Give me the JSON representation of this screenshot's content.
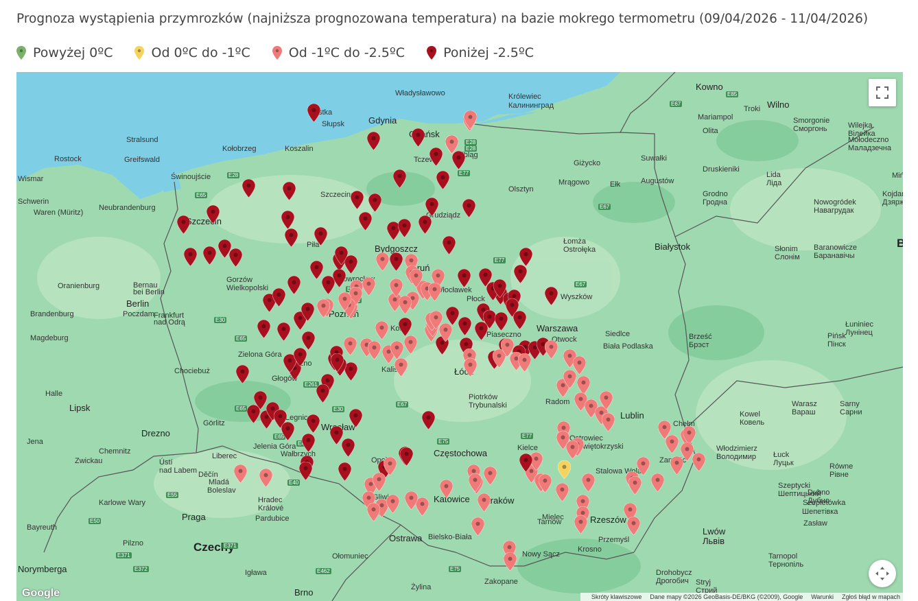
{
  "title": "Prognoza wystąpienia przymrozków (najniższa prognozowana temperatura) na bazie mokrego termometru (09/04/2026 - 11/04/2026)",
  "legend": [
    {
      "label": "Powyżej 0ºC",
      "color": "#7bb26a"
    },
    {
      "label": "Od 0ºC do -1ºC",
      "color": "#f5d35f"
    },
    {
      "label": "Od -1ºC do -2.5ºC",
      "color": "#f07a78"
    },
    {
      "label": "Poniżej -2.5ºC",
      "color": "#a8101e"
    }
  ],
  "map": {
    "icons": {
      "fullscreen": "fullscreen-icon",
      "camera": "camera-move-icon"
    },
    "attribution": {
      "shortcuts": "Skróty klawiszowe",
      "data": "Dane mapy ©2026 GeoBasis-DE/BKG (©2009), Google",
      "terms": "Warunki",
      "report": "Zgłoś błąd w mapach"
    },
    "logo": "Google",
    "labels": [
      {
        "t": "Władysławowo",
        "c": "lbl"
      },
      {
        "t": "Gdynia",
        "c": "lbl city"
      },
      {
        "t": "Gdańsk",
        "c": "lbl city"
      },
      {
        "t": "Ustka",
        "c": "lbl"
      },
      {
        "t": "Słupsk",
        "c": "lbl"
      },
      {
        "t": "Koszalin",
        "c": "lbl"
      },
      {
        "t": "Kołobrzeg",
        "c": "lbl"
      },
      {
        "t": "Tczew",
        "c": "lbl"
      },
      {
        "t": "Elbląg",
        "c": "lbl"
      },
      {
        "t": "Olsztyn",
        "c": "lbl"
      },
      {
        "t": "Królewiec",
        "c": "lbl"
      },
      {
        "t": "Калининград",
        "c": "lbl"
      },
      {
        "t": "Stralsund",
        "c": "lbl"
      },
      {
        "t": "Rostock",
        "c": "lbl"
      },
      {
        "t": "Greifswald",
        "c": "lbl"
      },
      {
        "t": "Wismar",
        "c": "lbl"
      },
      {
        "t": "Świnoujście",
        "c": "lbl"
      },
      {
        "t": "Schwerin",
        "c": "lbl"
      },
      {
        "t": "Neubrandenburg",
        "c": "lbl"
      },
      {
        "t": "Waren (Müritz)",
        "c": "lbl"
      },
      {
        "t": "Szczecin",
        "c": "lbl city"
      },
      {
        "t": "Szczecinek",
        "c": "lbl"
      },
      {
        "t": "Grudziądz",
        "c": "lbl"
      },
      {
        "t": "Bydgoszcz",
        "c": "lbl city"
      },
      {
        "t": "Toruń",
        "c": "lbl city"
      },
      {
        "t": "Piła",
        "c": "lbl"
      },
      {
        "t": "Inowrocław",
        "c": "lbl"
      },
      {
        "t": "Włocławek",
        "c": "lbl"
      },
      {
        "t": "Płock",
        "c": "lbl"
      },
      {
        "t": "Gorzów",
        "c": "lbl"
      },
      {
        "t": "Wielkopolski",
        "c": "lbl"
      },
      {
        "t": "Berlin",
        "c": "lbl city"
      },
      {
        "t": "Bernau",
        "c": "lbl"
      },
      {
        "t": "bei Berlin",
        "c": "lbl"
      },
      {
        "t": "Oranienburg",
        "c": "lbl"
      },
      {
        "t": "Poczdam",
        "c": "lbl"
      },
      {
        "t": "Brandenburg",
        "c": "lbl"
      },
      {
        "t": "Frankfurt",
        "c": "lbl"
      },
      {
        "t": "nad Odrą",
        "c": "lbl"
      },
      {
        "t": "Poznań",
        "c": "lbl city"
      },
      {
        "t": "Konin",
        "c": "lbl"
      },
      {
        "t": "Magdeburg",
        "c": "lbl"
      },
      {
        "t": "Zielona Góra",
        "c": "lbl"
      },
      {
        "t": "Leszno",
        "c": "lbl"
      },
      {
        "t": "Kalisz",
        "c": "lbl"
      },
      {
        "t": "Łódź",
        "c": "lbl city"
      },
      {
        "t": "Warszawa",
        "c": "lbl city"
      },
      {
        "t": "Piaseczno",
        "c": "lbl"
      },
      {
        "t": "Otwock",
        "c": "lbl"
      },
      {
        "t": "Chociebuż",
        "c": "lbl"
      },
      {
        "t": "Głogów",
        "c": "lbl"
      },
      {
        "t": "Halle",
        "c": "lbl"
      },
      {
        "t": "Lipsk",
        "c": "lbl city"
      },
      {
        "t": "Legnica",
        "c": "lbl"
      },
      {
        "t": "Wrocław",
        "c": "lbl city"
      },
      {
        "t": "Piotrków",
        "c": "lbl"
      },
      {
        "t": "Trybunalski",
        "c": "lbl"
      },
      {
        "t": "Radom",
        "c": "lbl"
      },
      {
        "t": "Lublin",
        "c": "lbl city"
      },
      {
        "t": "Drezno",
        "c": "lbl city"
      },
      {
        "t": "Görlitz",
        "c": "lbl"
      },
      {
        "t": "Jelenia Góra",
        "c": "lbl"
      },
      {
        "t": "Wałbrzych",
        "c": "lbl"
      },
      {
        "t": "Opole",
        "c": "lbl"
      },
      {
        "t": "Częstochowa",
        "c": "lbl city"
      },
      {
        "t": "Kielce",
        "c": "lbl"
      },
      {
        "t": "Ostrowiec",
        "c": "lbl"
      },
      {
        "t": "Świętokrzyski",
        "c": "lbl"
      },
      {
        "t": "Stalowa Wola",
        "c": "lbl"
      },
      {
        "t": "Zamość",
        "c": "lbl"
      },
      {
        "t": "Jena",
        "c": "lbl"
      },
      {
        "t": "Chemnitz",
        "c": "lbl"
      },
      {
        "t": "Zwickau",
        "c": "lbl"
      },
      {
        "t": "Liberec",
        "c": "lbl"
      },
      {
        "t": "Ústí",
        "c": "lbl"
      },
      {
        "t": "nad Labem",
        "c": "lbl"
      },
      {
        "t": "Děčín",
        "c": "lbl"
      },
      {
        "t": "Mladá",
        "c": "lbl"
      },
      {
        "t": "Boleslav",
        "c": "lbl"
      },
      {
        "t": "Hradec",
        "c": "lbl"
      },
      {
        "t": "Králové",
        "c": "lbl"
      },
      {
        "t": "Pardubice",
        "c": "lbl"
      },
      {
        "t": "Praga",
        "c": "lbl city"
      },
      {
        "t": "Karlowe Wary",
        "c": "lbl"
      },
      {
        "t": "Gliwice",
        "c": "lbl"
      },
      {
        "t": "Katowice",
        "c": "lbl city"
      },
      {
        "t": "Kraków",
        "c": "lbl city"
      },
      {
        "t": "Tarnów",
        "c": "lbl"
      },
      {
        "t": "Mielec",
        "c": "lbl"
      },
      {
        "t": "Rzeszów",
        "c": "lbl city"
      },
      {
        "t": "Przemyśl",
        "c": "lbl"
      },
      {
        "t": "Krosno",
        "c": "lbl"
      },
      {
        "t": "Nowy Sącz",
        "c": "lbl"
      },
      {
        "t": "Bielsko-Biała",
        "c": "lbl"
      },
      {
        "t": "Ostrawa",
        "c": "lbl city"
      },
      {
        "t": "Zakopane",
        "c": "lbl"
      },
      {
        "t": "Żylina",
        "c": "lbl"
      },
      {
        "t": "Brno",
        "c": "lbl city"
      },
      {
        "t": "Ołomuniec",
        "c": "lbl"
      },
      {
        "t": "Igława",
        "c": "lbl"
      },
      {
        "t": "Pilzno",
        "c": "lbl"
      },
      {
        "t": "Bayreuth",
        "c": "lbl"
      },
      {
        "t": "Norymberga",
        "c": "lbl city"
      },
      {
        "t": "Czechy",
        "c": "lbl big"
      },
      {
        "t": "Łomża",
        "c": "lbl"
      },
      {
        "t": "Białystok",
        "c": "lbl city"
      },
      {
        "t": "Ostrołęka",
        "c": "lbl"
      },
      {
        "t": "Wyszków",
        "c": "lbl"
      },
      {
        "t": "Siedlce",
        "c": "lbl"
      },
      {
        "t": "Biała Podlaska",
        "c": "lbl"
      },
      {
        "t": "Chełm",
        "c": "lbl"
      },
      {
        "t": "Mrągowo",
        "c": "lbl"
      },
      {
        "t": "Ełk",
        "c": "lbl"
      },
      {
        "t": "Giżycko",
        "c": "lbl"
      },
      {
        "t": "Suwałki",
        "c": "lbl"
      },
      {
        "t": "Augustów",
        "c": "lbl"
      },
      {
        "t": "Kowno",
        "c": "lbl city"
      },
      {
        "t": "Wilno",
        "c": "lbl city"
      },
      {
        "t": "Troki",
        "c": "lbl"
      },
      {
        "t": "Olita",
        "c": "lbl"
      },
      {
        "t": "Mariampol",
        "c": "lbl"
      },
      {
        "t": "Druskieniki",
        "c": "lbl"
      },
      {
        "t": "Grodno",
        "c": "lbl"
      },
      {
        "t": "Гродна",
        "c": "lbl"
      },
      {
        "t": "Lida",
        "c": "lbl"
      },
      {
        "t": "Ліда",
        "c": "lbl"
      },
      {
        "t": "Smorgonie",
        "c": "lbl"
      },
      {
        "t": "Сморгонь",
        "c": "lbl"
      },
      {
        "t": "Wilejka",
        "c": "lbl"
      },
      {
        "t": "Вілейка",
        "c": "lbl"
      },
      {
        "t": "Mołodeczno",
        "c": "lbl"
      },
      {
        "t": "Маладзечна",
        "c": "lbl"
      },
      {
        "t": "Nowogródek",
        "c": "lbl"
      },
      {
        "t": "Навагрудак",
        "c": "lbl"
      },
      {
        "t": "Kojdanów",
        "c": "lbl"
      },
      {
        "t": "Дзяржынск",
        "c": "lbl"
      },
      {
        "t": "Baranowicze",
        "c": "lbl"
      },
      {
        "t": "Баранавічы",
        "c": "lbl"
      },
      {
        "t": "Słonim",
        "c": "lbl"
      },
      {
        "t": "Слонім",
        "c": "lbl"
      },
      {
        "t": "Brześć",
        "c": "lbl"
      },
      {
        "t": "Брэст",
        "c": "lbl"
      },
      {
        "t": "Pińsk",
        "c": "lbl"
      },
      {
        "t": "Пінск",
        "c": "lbl"
      },
      {
        "t": "Łuniniec",
        "c": "lbl"
      },
      {
        "t": "Лунінец",
        "c": "lbl"
      },
      {
        "t": "Kowel",
        "c": "lbl"
      },
      {
        "t": "Ковель",
        "c": "lbl"
      },
      {
        "t": "Warasz",
        "c": "lbl"
      },
      {
        "t": "Вараш",
        "c": "lbl"
      },
      {
        "t": "Sarny",
        "c": "lbl"
      },
      {
        "t": "Сарни",
        "c": "lbl"
      },
      {
        "t": "Łuck",
        "c": "lbl"
      },
      {
        "t": "Луцьк",
        "c": "lbl"
      },
      {
        "t": "Równe",
        "c": "lbl"
      },
      {
        "t": "Рівне",
        "c": "lbl"
      },
      {
        "t": "Włodzimierz",
        "c": "lbl"
      },
      {
        "t": "Володимир",
        "c": "lbl"
      },
      {
        "t": "Szeptycki",
        "c": "lbl"
      },
      {
        "t": "Шептицький",
        "c": "lbl"
      },
      {
        "t": "Dubno",
        "c": "lbl"
      },
      {
        "t": "Дубно",
        "c": "lbl"
      },
      {
        "t": "Zasław",
        "c": "lbl"
      },
      {
        "t": "Szepietówka",
        "c": "lbl"
      },
      {
        "t": "Шепетівка",
        "c": "lbl"
      },
      {
        "t": "Lwów",
        "c": "lbl city"
      },
      {
        "t": "Львів",
        "c": "lbl city"
      },
      {
        "t": "Tarnopol",
        "c": "lbl"
      },
      {
        "t": "Тернопіль",
        "c": "lbl"
      },
      {
        "t": "Drohobycz",
        "c": "lbl"
      },
      {
        "t": "Дрогобич",
        "c": "lbl"
      },
      {
        "t": "Stryj",
        "c": "lbl"
      },
      {
        "t": "Стрий",
        "c": "lbl"
      },
      {
        "t": "Mińsk",
        "c": "lbl"
      },
      {
        "t": "Białoruś",
        "c": "lbl big"
      }
    ],
    "roads": [
      "E28",
      "E65",
      "E28",
      "E77",
      "E28",
      "E77",
      "E67",
      "E67",
      "E85",
      "E67",
      "E65",
      "E30",
      "E261",
      "E261",
      "E261",
      "E65",
      "E65",
      "E30",
      "E40",
      "E40",
      "E75",
      "E77",
      "E67",
      "E462",
      "E55",
      "E50",
      "E371",
      "E372",
      "E371",
      "E75"
    ],
    "markers": [
      {
        "level": 3
      },
      {
        "level": 2
      },
      {
        "level": 3
      },
      {
        "level": 3
      },
      {
        "level": 2
      },
      {
        "level": 3
      },
      {
        "level": 3
      },
      {
        "level": 3
      },
      {
        "level": 3
      },
      {
        "level": 3
      },
      {
        "level": 3
      },
      {
        "level": 3
      },
      {
        "level": 3
      },
      {
        "level": 3
      },
      {
        "level": 3
      },
      {
        "level": 3
      },
      {
        "level": 3
      },
      {
        "level": 3
      },
      {
        "level": 3
      },
      {
        "level": 3
      },
      {
        "level": 3
      },
      {
        "level": 3
      },
      {
        "level": 3
      },
      {
        "level": 3
      },
      {
        "level": 3
      },
      {
        "level": 3
      },
      {
        "level": 3
      },
      {
        "level": 3
      },
      {
        "level": 3
      },
      {
        "level": 3
      },
      {
        "level": 3
      },
      {
        "level": 3
      },
      {
        "level": 3
      },
      {
        "level": 3
      },
      {
        "level": 3
      },
      {
        "level": 3
      },
      {
        "level": 3
      },
      {
        "level": 3
      },
      {
        "level": 3
      },
      {
        "level": 3
      },
      {
        "level": 3
      },
      {
        "level": 3
      },
      {
        "level": 3
      },
      {
        "level": 3
      },
      {
        "level": 3
      },
      {
        "level": 3
      },
      {
        "level": 3
      },
      {
        "level": 3
      },
      {
        "level": 3
      },
      {
        "level": 3
      },
      {
        "level": 3
      },
      {
        "level": 3
      },
      {
        "level": 3
      },
      {
        "level": 3
      },
      {
        "level": 3
      },
      {
        "level": 3
      },
      {
        "level": 3
      },
      {
        "level": 3
      },
      {
        "level": 3
      },
      {
        "level": 3
      },
      {
        "level": 3
      },
      {
        "level": 3
      },
      {
        "level": 3
      },
      {
        "level": 3
      },
      {
        "level": 3
      },
      {
        "level": 3
      },
      {
        "level": 3
      },
      {
        "level": 3
      },
      {
        "level": 3
      },
      {
        "level": 3
      },
      {
        "level": 3
      },
      {
        "level": 3
      },
      {
        "level": 3
      },
      {
        "level": 3
      },
      {
        "level": 3
      },
      {
        "level": 3
      },
      {
        "level": 3
      },
      {
        "level": 3
      },
      {
        "level": 3
      },
      {
        "level": 3
      },
      {
        "level": 3
      },
      {
        "level": 3
      },
      {
        "level": 3
      },
      {
        "level": 3
      },
      {
        "level": 3
      },
      {
        "level": 3
      },
      {
        "level": 3
      },
      {
        "level": 3
      },
      {
        "level": 3
      },
      {
        "level": 3
      },
      {
        "level": 3
      },
      {
        "level": 3
      },
      {
        "level": 3
      },
      {
        "level": 3
      },
      {
        "level": 3
      },
      {
        "level": 3
      },
      {
        "level": 3
      },
      {
        "level": 3
      },
      {
        "level": 3
      },
      {
        "level": 3
      },
      {
        "level": 2
      },
      {
        "level": 2
      },
      {
        "level": 2
      },
      {
        "level": 2
      },
      {
        "level": 2
      },
      {
        "level": 2
      },
      {
        "level": 2
      },
      {
        "level": 2
      },
      {
        "level": 2
      },
      {
        "level": 2
      },
      {
        "level": 2
      },
      {
        "level": 2
      },
      {
        "level": 2
      },
      {
        "level": 2
      },
      {
        "level": 2
      },
      {
        "level": 2
      },
      {
        "level": 2
      },
      {
        "level": 2
      },
      {
        "level": 2
      },
      {
        "level": 2
      },
      {
        "level": 2
      },
      {
        "level": 2
      },
      {
        "level": 2
      },
      {
        "level": 2
      },
      {
        "level": 2
      },
      {
        "level": 2
      },
      {
        "level": 2
      },
      {
        "level": 2
      },
      {
        "level": 2
      },
      {
        "level": 2
      },
      {
        "level": 2
      },
      {
        "level": 2
      },
      {
        "level": 2
      },
      {
        "level": 2
      },
      {
        "level": 2
      },
      {
        "level": 2
      },
      {
        "level": 2
      },
      {
        "level": 2
      },
      {
        "level": 2
      },
      {
        "level": 2
      },
      {
        "level": 2
      },
      {
        "level": 2
      },
      {
        "level": 2
      },
      {
        "level": 2
      },
      {
        "level": 2
      },
      {
        "level": 2
      },
      {
        "level": 2
      },
      {
        "level": 2
      },
      {
        "level": 2
      },
      {
        "level": 2
      },
      {
        "level": 2
      },
      {
        "level": 2
      },
      {
        "level": 2
      },
      {
        "level": 2
      },
      {
        "level": 2
      },
      {
        "level": 2
      },
      {
        "level": 2
      },
      {
        "level": 2
      },
      {
        "level": 2
      },
      {
        "level": 2
      },
      {
        "level": 2
      },
      {
        "level": 2
      },
      {
        "level": 2
      },
      {
        "level": 2
      },
      {
        "level": 2
      },
      {
        "level": 2
      },
      {
        "level": 2
      },
      {
        "level": 2
      },
      {
        "level": 2
      },
      {
        "level": 2
      },
      {
        "level": 2
      },
      {
        "level": 2
      },
      {
        "level": 2
      },
      {
        "level": 2
      },
      {
        "level": 2
      },
      {
        "level": 2
      },
      {
        "level": 2
      },
      {
        "level": 2
      },
      {
        "level": 2
      },
      {
        "level": 2
      },
      {
        "level": 2
      },
      {
        "level": 2
      },
      {
        "level": 2
      },
      {
        "level": 2
      },
      {
        "level": 2
      },
      {
        "level": 2
      },
      {
        "level": 2
      },
      {
        "level": 2
      },
      {
        "level": 2
      },
      {
        "level": 2
      },
      {
        "level": 2
      },
      {
        "level": 2
      },
      {
        "level": 2
      },
      {
        "level": 2
      },
      {
        "level": 2
      },
      {
        "level": 2
      },
      {
        "level": 2
      },
      {
        "level": 2
      },
      {
        "level": 1
      },
      {
        "level": 3
      }
    ]
  }
}
